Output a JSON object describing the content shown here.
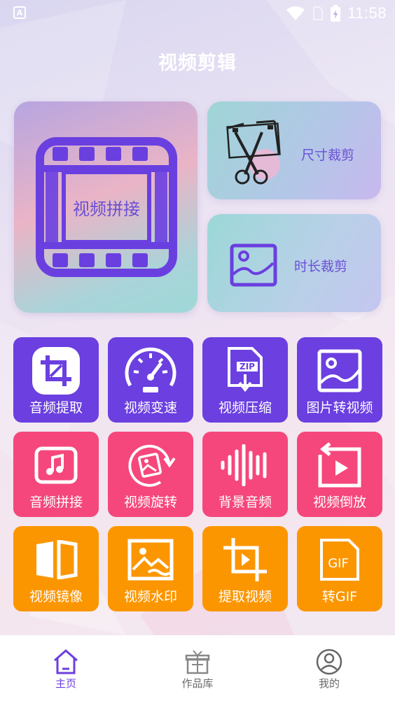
{
  "status_bar": {
    "notification_letter": "A",
    "time": "11:58",
    "icons": [
      "wifi-icon",
      "sim-icon",
      "battery-charging-icon"
    ]
  },
  "page_title": "视频剪辑",
  "hero": {
    "label": "视频拼接",
    "icon": "film-strip-icon"
  },
  "side_cards": [
    {
      "label": "尺寸裁剪",
      "icon": "scissors-film-icon"
    },
    {
      "label": "时长裁剪",
      "icon": "image-frame-icon"
    }
  ],
  "tiles": [
    {
      "label": "音频提取",
      "icon": "crop-icon",
      "color": "#6b3fe0"
    },
    {
      "label": "视频变速",
      "icon": "speedometer-icon",
      "color": "#6b3fe0"
    },
    {
      "label": "视频压缩",
      "icon": "zip-file-icon",
      "color": "#6b3fe0"
    },
    {
      "label": "图片转视频",
      "icon": "picture-icon",
      "color": "#6b3fe0"
    },
    {
      "label": "音频拼接",
      "icon": "music-note-icon",
      "color": "#f5477c"
    },
    {
      "label": "视频旋转",
      "icon": "rotate-image-icon",
      "color": "#f5477c"
    },
    {
      "label": "背景音频",
      "icon": "audio-wave-icon",
      "color": "#f5477c"
    },
    {
      "label": "视频倒放",
      "icon": "reverse-play-icon",
      "color": "#f5477c"
    },
    {
      "label": "视频镜像",
      "icon": "mirror-icon",
      "color": "#fc9600"
    },
    {
      "label": "视频水印",
      "icon": "watermark-icon",
      "color": "#fc9600"
    },
    {
      "label": "提取视频",
      "icon": "extract-video-icon",
      "color": "#fc9600"
    },
    {
      "label": "转GIF",
      "icon": "gif-file-icon",
      "color": "#fc9600"
    }
  ],
  "bottom_nav": [
    {
      "label": "主页",
      "icon": "home-icon",
      "active": true
    },
    {
      "label": "作品库",
      "icon": "gift-box-icon",
      "active": false
    },
    {
      "label": "我的",
      "icon": "user-profile-icon",
      "active": false
    }
  ],
  "colors": {
    "accent_purple": "#6b3fe0",
    "accent_pink": "#f5477c",
    "accent_orange": "#fc9600"
  }
}
